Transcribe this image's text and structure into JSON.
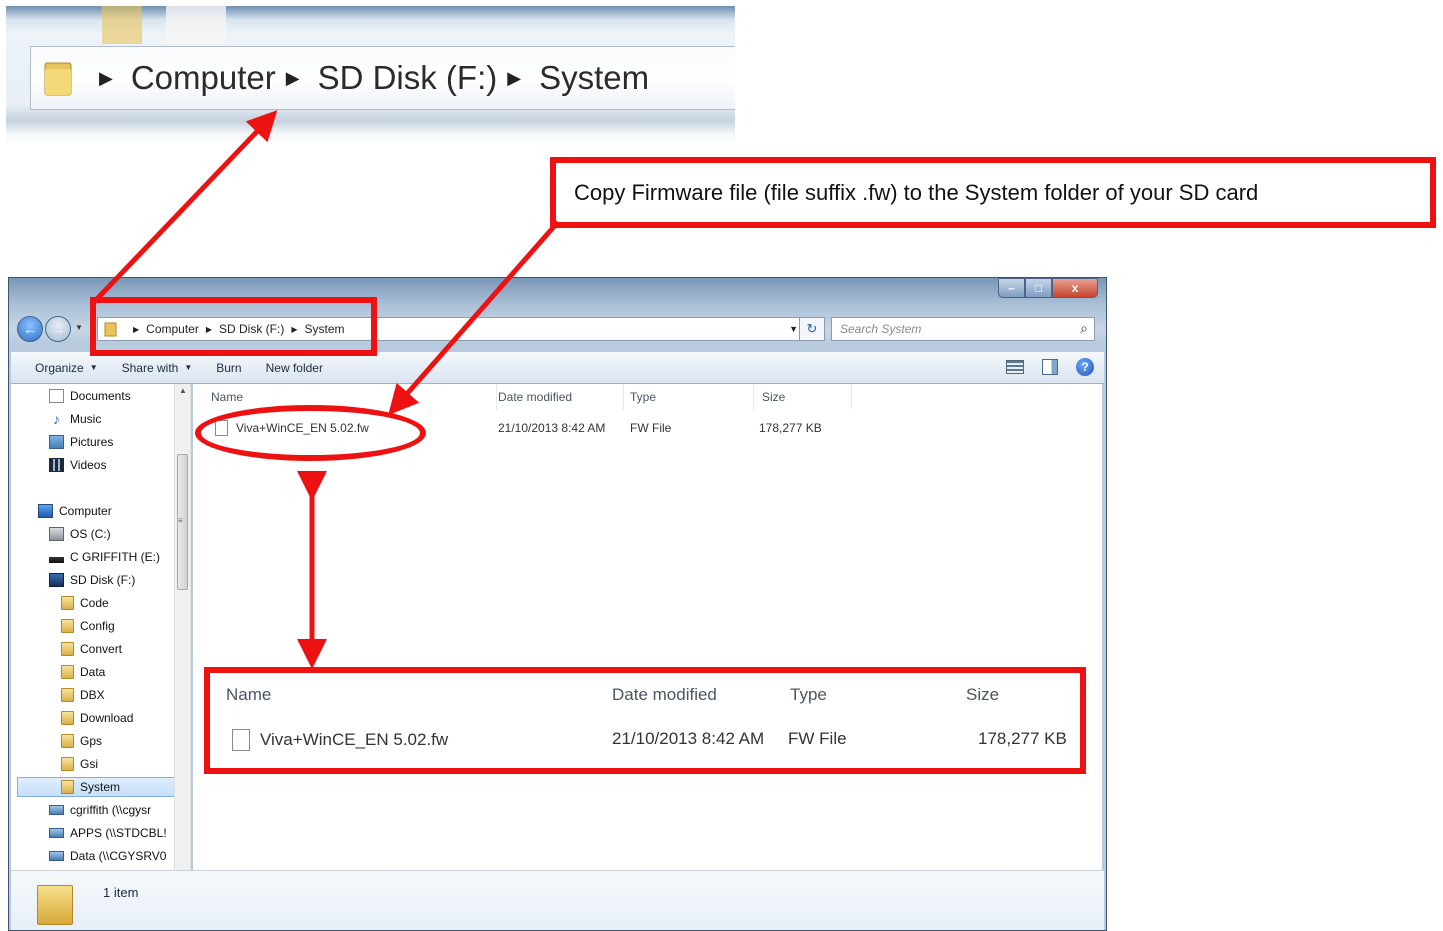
{
  "zoomed_breadcrumb": {
    "items": [
      "Computer",
      "SD Disk (F:)",
      "System"
    ]
  },
  "callout": {
    "text": "Copy Firmware file (file suffix .fw) to the System folder of your SD card"
  },
  "window": {
    "controls": {
      "minimize": "–",
      "maximize": "□",
      "close": "x"
    },
    "address": {
      "items": [
        "Computer",
        "SD Disk (F:)",
        "System"
      ]
    },
    "search": {
      "placeholder": "Search System"
    },
    "toolbar": {
      "organize": "Organize",
      "share_with": "Share with",
      "burn": "Burn",
      "new_folder": "New folder"
    },
    "sidebar": {
      "items": [
        {
          "label": "Documents",
          "icon": "documents-icon"
        },
        {
          "label": "Music",
          "icon": "music-icon"
        },
        {
          "label": "Pictures",
          "icon": "pictures-icon"
        },
        {
          "label": "Videos",
          "icon": "videos-icon"
        },
        {
          "label": "Computer",
          "icon": "computer-icon"
        },
        {
          "label": "OS (C:)",
          "icon": "drive-icon"
        },
        {
          "label": "C GRIFFITH (E:)",
          "icon": "usb-drive-icon"
        },
        {
          "label": "SD Disk (F:)",
          "icon": "sd-card-icon"
        },
        {
          "label": "Code",
          "icon": "folder-icon"
        },
        {
          "label": "Config",
          "icon": "folder-icon"
        },
        {
          "label": "Convert",
          "icon": "folder-icon"
        },
        {
          "label": "Data",
          "icon": "folder-icon"
        },
        {
          "label": "DBX",
          "icon": "folder-icon"
        },
        {
          "label": "Download",
          "icon": "folder-icon"
        },
        {
          "label": "Gps",
          "icon": "folder-icon"
        },
        {
          "label": "Gsi",
          "icon": "folder-icon"
        },
        {
          "label": "System",
          "icon": "folder-icon",
          "selected": true
        },
        {
          "label": "cgriffith (\\\\cgysr",
          "icon": "network-drive-icon"
        },
        {
          "label": "APPS (\\\\STDCBL!",
          "icon": "network-drive-icon"
        },
        {
          "label": "Data (\\\\CGYSRV0",
          "icon": "network-drive-icon"
        }
      ]
    },
    "columns": [
      "Name",
      "Date modified",
      "Type",
      "Size"
    ],
    "files": [
      {
        "name": "Viva+WinCE_EN 5.02.fw",
        "date_modified": "21/10/2013 8:42 AM",
        "type": "FW File",
        "size": "178,277 KB"
      }
    ],
    "status": {
      "item_count": "1 item"
    }
  },
  "zoomed_detail": {
    "columns": [
      "Name",
      "Date modified",
      "Type",
      "Size"
    ],
    "file": {
      "name": "Viva+WinCE_EN 5.02.fw",
      "date_modified": "21/10/2013 8:42 AM",
      "type": "FW File",
      "size": "178,277 KB"
    }
  },
  "colors": {
    "annotation_red": "#ee1111",
    "selection_blue": "#c4e0fa"
  }
}
